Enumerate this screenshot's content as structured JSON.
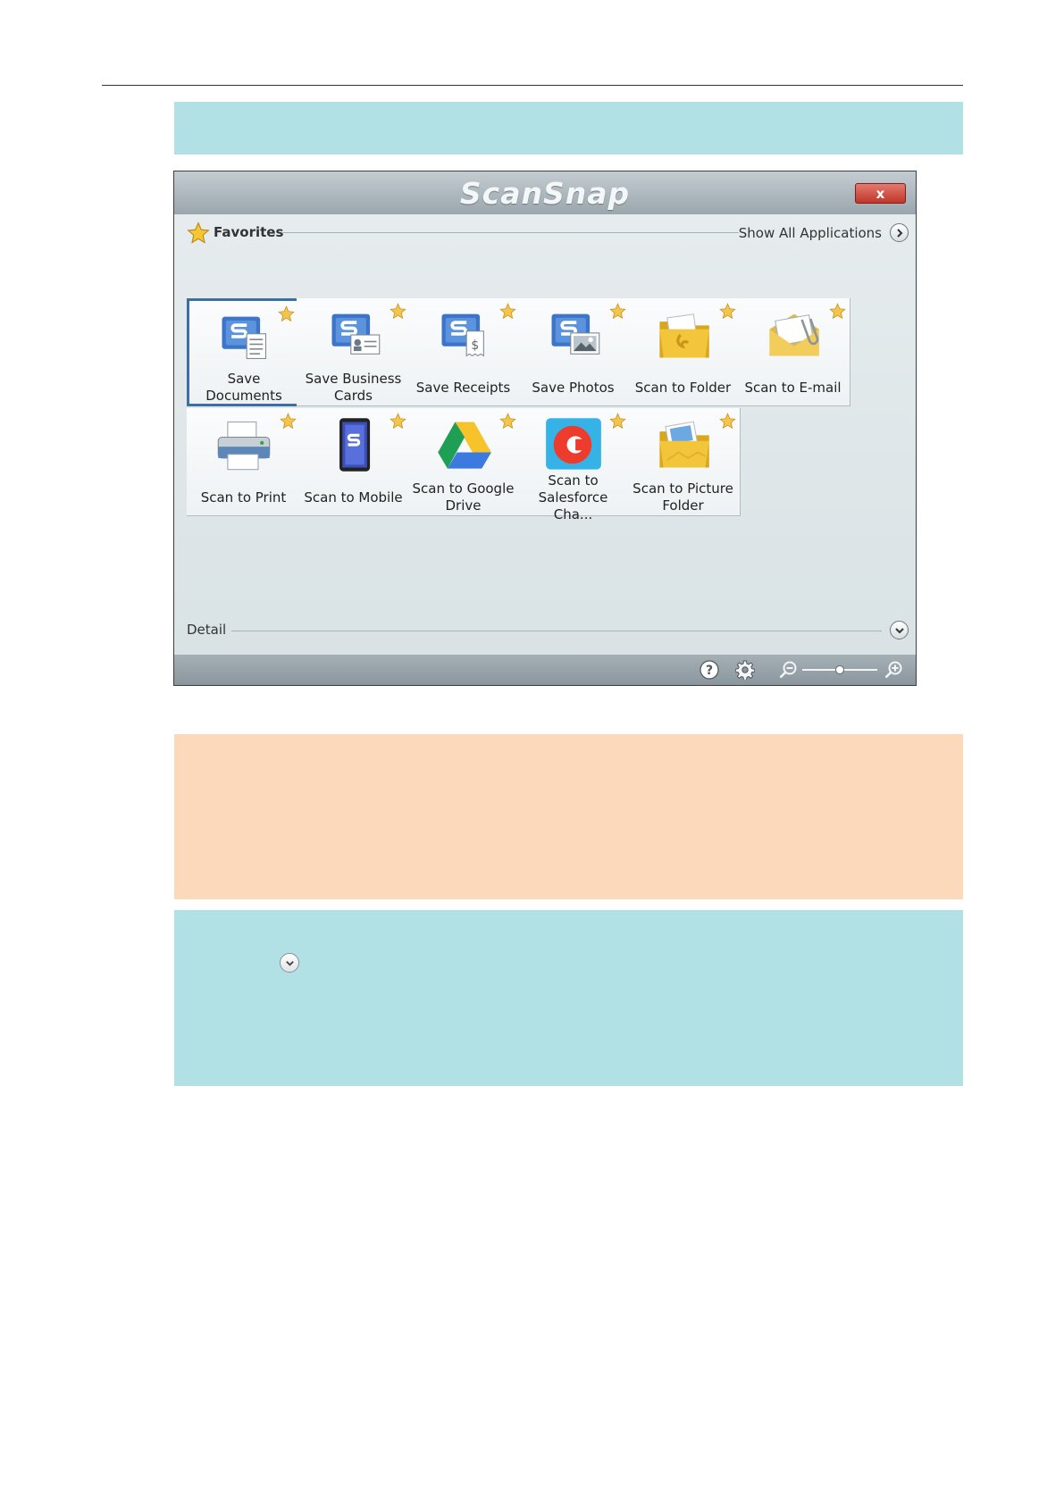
{
  "window": {
    "logo_text": "ScanSnap",
    "close_label": "x"
  },
  "favorites": {
    "label": "Favorites",
    "show_all_label": "Show All Applications"
  },
  "tiles": [
    {
      "label": "Save Documents",
      "icon": "save-documents-icon",
      "selected": true
    },
    {
      "label": "Save Business Cards",
      "icon": "save-business-cards-icon"
    },
    {
      "label": "Save Receipts",
      "icon": "save-receipts-icon"
    },
    {
      "label": "Save Photos",
      "icon": "save-photos-icon"
    },
    {
      "label": "Scan to Folder",
      "icon": "folder-icon"
    },
    {
      "label": "Scan to E-mail",
      "icon": "email-icon"
    },
    {
      "label": "Scan to Print",
      "icon": "printer-icon"
    },
    {
      "label": "Scan to Mobile",
      "icon": "mobile-icon"
    },
    {
      "label": "Scan to Google Drive",
      "icon": "google-drive-icon"
    },
    {
      "label": "Scan to Salesforce Cha...",
      "icon": "salesforce-chatter-icon"
    },
    {
      "label": "Scan to Picture Folder",
      "icon": "picture-folder-icon"
    }
  ],
  "detail": {
    "label": "Detail"
  },
  "toolbar": {
    "help_icon": "help-icon",
    "settings_icon": "gear-icon",
    "zoom_out_icon": "zoom-out-icon",
    "zoom_in_icon": "zoom-in-icon",
    "zoom_level": 0.5
  },
  "colors": {
    "note_blue": "#b1e0e5",
    "caution_orange": "#fdd9bc",
    "selected_border": "#3d6fa3"
  }
}
